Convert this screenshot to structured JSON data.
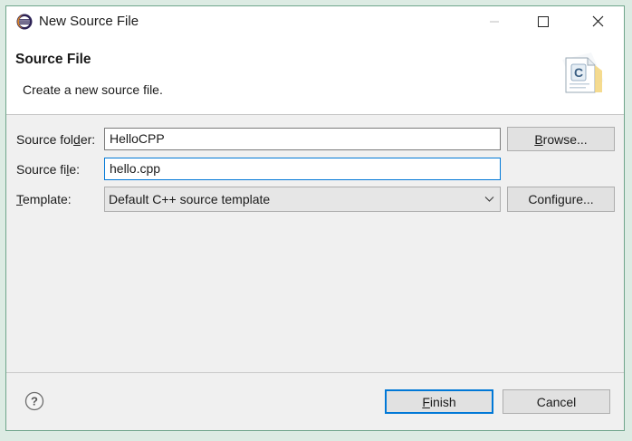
{
  "window": {
    "title": "New Source File"
  },
  "header": {
    "title": "Source File",
    "description": "Create a new source file.",
    "icon": "c-source-file-icon"
  },
  "form": {
    "source_folder": {
      "label_pre": "Source fol",
      "label_mnemonic": "d",
      "label_post": "er:",
      "value": "HelloCPP",
      "browse_pre": "",
      "browse_mnemonic": "B",
      "browse_post": "rowse..."
    },
    "source_file": {
      "label_pre": "Source fi",
      "label_mnemonic": "l",
      "label_post": "e:",
      "value": "hello.cpp"
    },
    "template": {
      "label_pre": "",
      "label_mnemonic": "T",
      "label_post": "emplate:",
      "selected": "Default C++ source template",
      "configure_label": "Configure..."
    }
  },
  "footer": {
    "finish_pre": "",
    "finish_mnemonic": "F",
    "finish_post": "inish",
    "cancel_label": "Cancel"
  },
  "colors": {
    "accent": "#0078d7",
    "window_border": "#6fa58b"
  }
}
